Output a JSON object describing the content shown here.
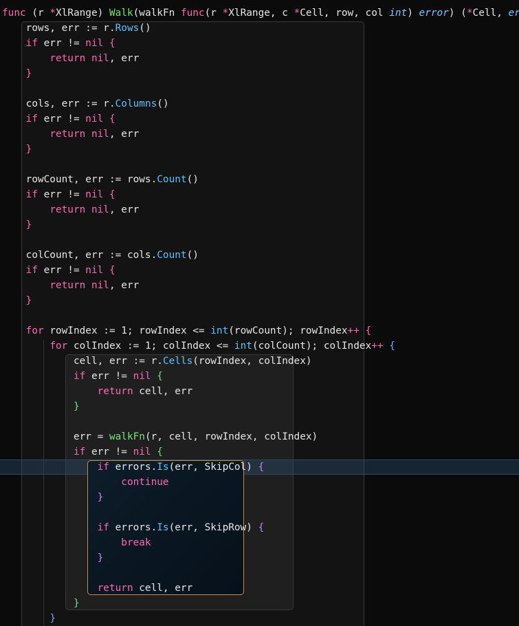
{
  "editor": {
    "language": "go",
    "lines": [
      [
        [
          "kw",
          "func"
        ],
        [
          "plain",
          " (r "
        ],
        [
          "star",
          "*"
        ],
        [
          "plain",
          "XlRange) "
        ],
        [
          "fn",
          "Walk"
        ],
        [
          "plain",
          "(walkFn "
        ],
        [
          "kw",
          "func"
        ],
        [
          "plain",
          "(r "
        ],
        [
          "star",
          "*"
        ],
        [
          "plain",
          "XlRange, c "
        ],
        [
          "star",
          "*"
        ],
        [
          "plain",
          "Cell, row, col "
        ],
        [
          "type",
          "int"
        ],
        [
          "plain",
          ") "
        ],
        [
          "type",
          "error"
        ],
        [
          "plain",
          ") ("
        ],
        [
          "star",
          "*"
        ],
        [
          "plain",
          "Cell, "
        ],
        [
          "type",
          "error"
        ],
        [
          "plain",
          ") {"
        ]
      ],
      [
        [
          "plain",
          "    rows, err := r."
        ],
        [
          "method",
          "Rows"
        ],
        [
          "plain",
          "()"
        ]
      ],
      [
        [
          "plain",
          "    "
        ],
        [
          "kw",
          "if"
        ],
        [
          "plain",
          " err != "
        ],
        [
          "kw",
          "nil"
        ],
        [
          "plain",
          " "
        ],
        [
          "brace-pk",
          "{"
        ]
      ],
      [
        [
          "plain",
          "        "
        ],
        [
          "kw",
          "return"
        ],
        [
          "plain",
          " "
        ],
        [
          "kw",
          "nil"
        ],
        [
          "plain",
          ", err"
        ]
      ],
      [
        [
          "plain",
          "    "
        ],
        [
          "brace-pk",
          "}"
        ]
      ],
      [],
      [
        [
          "plain",
          "    cols, err := r."
        ],
        [
          "method",
          "Columns"
        ],
        [
          "plain",
          "()"
        ]
      ],
      [
        [
          "plain",
          "    "
        ],
        [
          "kw",
          "if"
        ],
        [
          "plain",
          " err != "
        ],
        [
          "kw",
          "nil"
        ],
        [
          "plain",
          " "
        ],
        [
          "brace-pk",
          "{"
        ]
      ],
      [
        [
          "plain",
          "        "
        ],
        [
          "kw",
          "return"
        ],
        [
          "plain",
          " "
        ],
        [
          "kw",
          "nil"
        ],
        [
          "plain",
          ", err"
        ]
      ],
      [
        [
          "plain",
          "    "
        ],
        [
          "brace-pk",
          "}"
        ]
      ],
      [],
      [
        [
          "plain",
          "    rowCount, err := rows."
        ],
        [
          "method",
          "Count"
        ],
        [
          "plain",
          "()"
        ]
      ],
      [
        [
          "plain",
          "    "
        ],
        [
          "kw",
          "if"
        ],
        [
          "plain",
          " err != "
        ],
        [
          "kw",
          "nil"
        ],
        [
          "plain",
          " "
        ],
        [
          "brace-pk",
          "{"
        ]
      ],
      [
        [
          "plain",
          "        "
        ],
        [
          "kw",
          "return"
        ],
        [
          "plain",
          " "
        ],
        [
          "kw",
          "nil"
        ],
        [
          "plain",
          ", err"
        ]
      ],
      [
        [
          "plain",
          "    "
        ],
        [
          "brace-pk",
          "}"
        ]
      ],
      [],
      [
        [
          "plain",
          "    colCount, err := cols."
        ],
        [
          "method",
          "Count"
        ],
        [
          "plain",
          "()"
        ]
      ],
      [
        [
          "plain",
          "    "
        ],
        [
          "kw",
          "if"
        ],
        [
          "plain",
          " err != "
        ],
        [
          "kw",
          "nil"
        ],
        [
          "plain",
          " "
        ],
        [
          "brace-pk",
          "{"
        ]
      ],
      [
        [
          "plain",
          "        "
        ],
        [
          "kw",
          "return"
        ],
        [
          "plain",
          " "
        ],
        [
          "kw",
          "nil"
        ],
        [
          "plain",
          ", err"
        ]
      ],
      [
        [
          "plain",
          "    "
        ],
        [
          "brace-pk",
          "}"
        ]
      ],
      [],
      [
        [
          "plain",
          "    "
        ],
        [
          "kw",
          "for"
        ],
        [
          "plain",
          " rowIndex := "
        ],
        [
          "plain",
          "1"
        ],
        [
          "plain",
          "; rowIndex <= "
        ],
        [
          "method",
          "int"
        ],
        [
          "plain",
          "(rowCount); rowIndex"
        ],
        [
          "kw",
          "++"
        ],
        [
          "plain",
          " "
        ],
        [
          "brace-pk",
          "{"
        ]
      ],
      [
        [
          "plain",
          "        "
        ],
        [
          "kw",
          "for"
        ],
        [
          "plain",
          " colIndex := "
        ],
        [
          "plain",
          "1"
        ],
        [
          "plain",
          "; colIndex <= "
        ],
        [
          "method",
          "int"
        ],
        [
          "plain",
          "(colCount); colIndex"
        ],
        [
          "kw",
          "++"
        ],
        [
          "plain",
          " "
        ],
        [
          "brace-b",
          "{"
        ]
      ],
      [
        [
          "plain",
          "            cell, err := r."
        ],
        [
          "method",
          "Cells"
        ],
        [
          "plain",
          "(rowIndex, colIndex)"
        ]
      ],
      [
        [
          "plain",
          "            "
        ],
        [
          "kw",
          "if"
        ],
        [
          "plain",
          " err != "
        ],
        [
          "kw",
          "nil"
        ],
        [
          "plain",
          " "
        ],
        [
          "brace-g",
          "{"
        ]
      ],
      [
        [
          "plain",
          "                "
        ],
        [
          "kw",
          "return"
        ],
        [
          "plain",
          " cell, err"
        ]
      ],
      [
        [
          "plain",
          "            "
        ],
        [
          "brace-g",
          "}"
        ]
      ],
      [],
      [
        [
          "plain",
          "            err = "
        ],
        [
          "fn",
          "walkFn"
        ],
        [
          "plain",
          "(r, cell, rowIndex, colIndex)"
        ]
      ],
      [
        [
          "plain",
          "            "
        ],
        [
          "kw",
          "if"
        ],
        [
          "plain",
          " err != "
        ],
        [
          "kw",
          "nil"
        ],
        [
          "plain",
          " "
        ],
        [
          "brace-g",
          "{"
        ]
      ],
      [
        [
          "plain",
          "                "
        ],
        [
          "kw",
          "if"
        ],
        [
          "plain",
          " errors."
        ],
        [
          "method",
          "Is"
        ],
        [
          "plain",
          "(err, SkipCol) "
        ],
        [
          "brace-p",
          "{"
        ]
      ],
      [
        [
          "plain",
          "                    "
        ],
        [
          "kw",
          "continue"
        ]
      ],
      [
        [
          "plain",
          "                "
        ],
        [
          "brace-p",
          "}"
        ]
      ],
      [],
      [
        [
          "plain",
          "                "
        ],
        [
          "kw",
          "if"
        ],
        [
          "plain",
          " errors."
        ],
        [
          "method",
          "Is"
        ],
        [
          "plain",
          "(err, SkipRow) "
        ],
        [
          "brace-p",
          "{"
        ]
      ],
      [
        [
          "plain",
          "                    "
        ],
        [
          "kw",
          "break"
        ]
      ],
      [
        [
          "plain",
          "                "
        ],
        [
          "brace-p",
          "}"
        ]
      ],
      [],
      [
        [
          "plain",
          "                "
        ],
        [
          "kw",
          "return"
        ],
        [
          "plain",
          " cell, err"
        ]
      ],
      [
        [
          "plain",
          "            "
        ],
        [
          "brace-g",
          "}"
        ]
      ],
      [
        [
          "plain",
          "        "
        ],
        [
          "brace-b",
          "}"
        ]
      ]
    ],
    "current_line_index": 30,
    "colors": {
      "background": "#0b0b0c",
      "keyword": "#ff6ab3",
      "function": "#78e47a",
      "type": "#7cc7ff",
      "method": "#5fc3ff",
      "highlight_border": "#c88a42"
    }
  }
}
